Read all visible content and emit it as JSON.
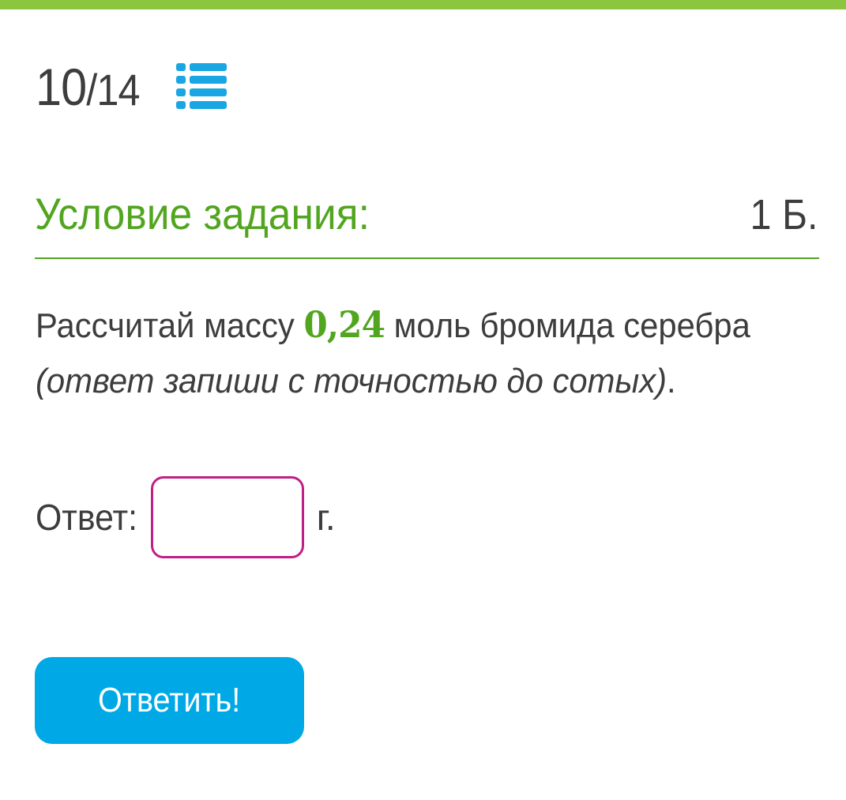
{
  "header": {
    "current": "10",
    "separator": "/",
    "total": "14",
    "list_icon": "list-icon"
  },
  "task": {
    "title": "Условие задания:",
    "points": "1 Б.",
    "question_before": "Рассчитай массу ",
    "question_number": "0,24",
    "question_after": " моль бромида серебра ",
    "question_hint": "(ответ запиши с точностью до сотых)",
    "question_end": "."
  },
  "answer": {
    "label": "Ответ:",
    "value": "",
    "unit": "г."
  },
  "submit": {
    "label": "Ответить!"
  },
  "colors": {
    "accent_green": "#52a51f",
    "top_bar": "#8cc63f",
    "button_blue": "#00a9e6",
    "input_border": "#c01f86",
    "icon_blue": "#1aa6e2"
  }
}
